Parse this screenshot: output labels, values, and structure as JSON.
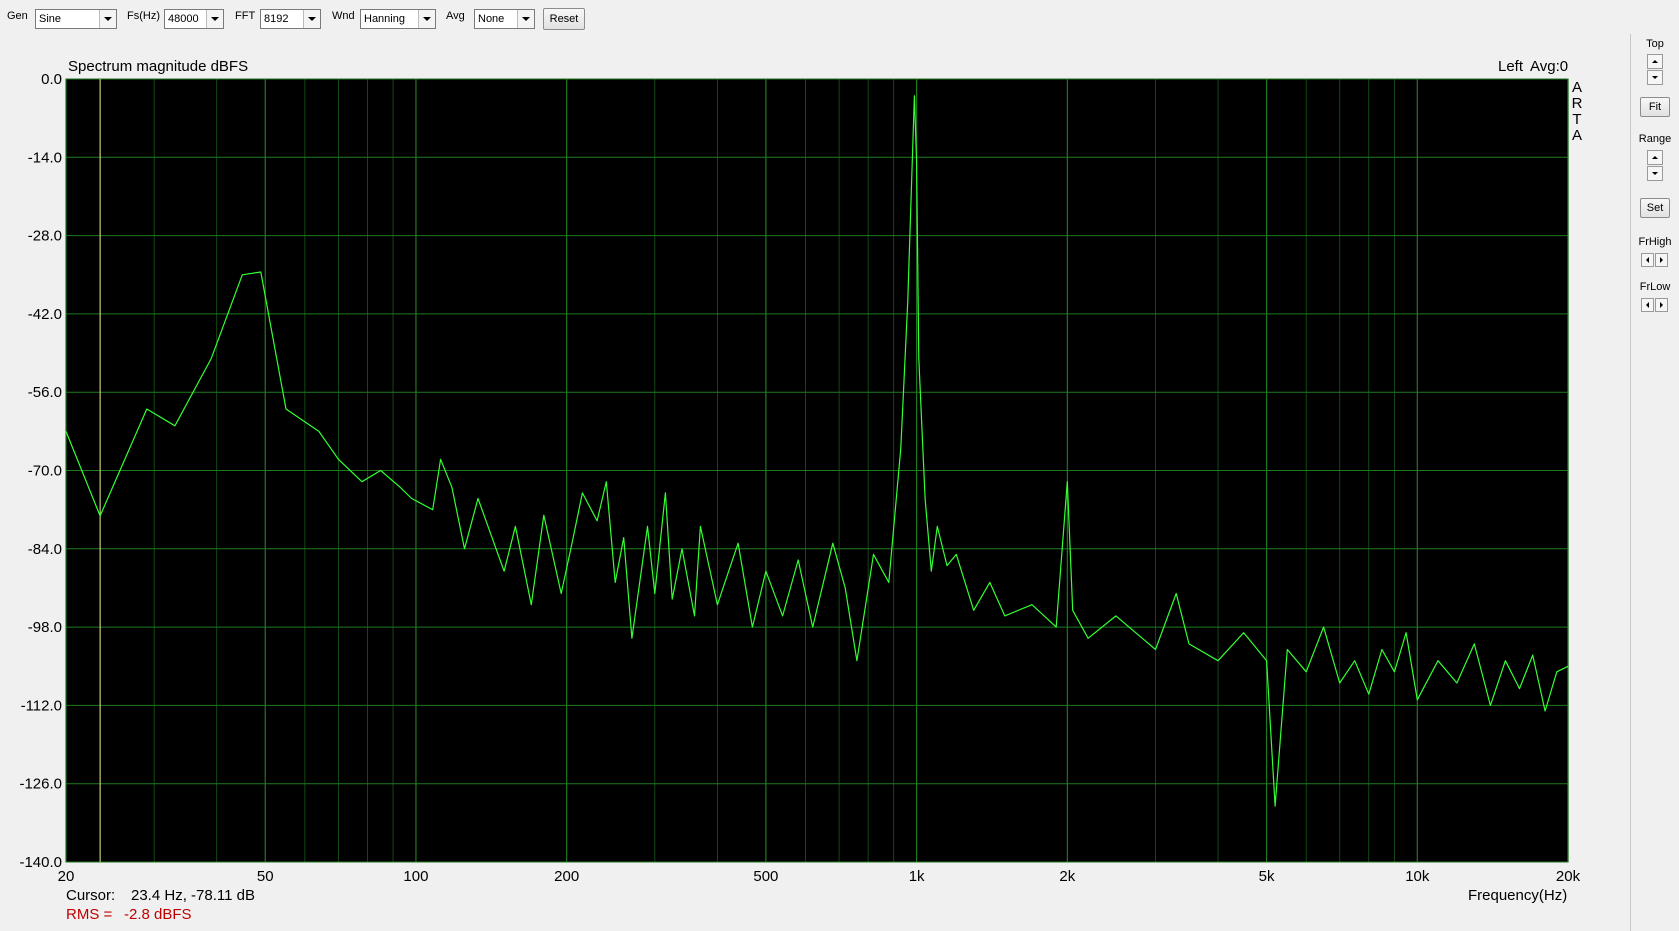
{
  "toolbar": {
    "gen_label": "Gen",
    "gen_value": "Sine",
    "fs_label": "Fs(Hz)",
    "fs_value": "48000",
    "fft_label": "FFT",
    "fft_value": "8192",
    "wnd_label": "Wnd",
    "wnd_value": "Hanning",
    "avg_label": "Avg",
    "avg_value": "None",
    "reset_label": "Reset"
  },
  "plot": {
    "title": "Spectrum magnitude dBFS",
    "channel": "Left",
    "avg_status": "Avg:0",
    "brand_letters": [
      "A",
      "R",
      "T",
      "A"
    ],
    "xaxis_title": "Frequency(Hz)",
    "cursor_label": "Cursor:",
    "cursor_value": "23.4 Hz, -78.11 dB",
    "rms_label": "RMS =",
    "rms_value": "-2.8 dBFS"
  },
  "panel": {
    "top_label": "Top",
    "fit_label": "Fit",
    "range_label": "Range",
    "set_label": "Set",
    "frhigh_label": "FrHigh",
    "frlow_label": "FrLow"
  },
  "colors": {
    "plot_background": "#000000",
    "grid": "#1f7a1f",
    "trace": "#33ff33",
    "cursor": "#c8c87a",
    "rms_text": "#c00000"
  },
  "chart_data": {
    "type": "line",
    "title": "Spectrum magnitude dBFS",
    "xlabel": "Frequency(Hz)",
    "ylabel": "",
    "xscale": "log",
    "xlim": [
      20,
      20000
    ],
    "ylim": [
      -140,
      0
    ],
    "grid": true,
    "xticks": [
      20,
      50,
      100,
      200,
      500,
      1000,
      2000,
      5000,
      10000,
      20000
    ],
    "xtick_labels": [
      "20",
      "50",
      "100",
      "200",
      "500",
      "1k",
      "2k",
      "5k",
      "10k",
      "20k"
    ],
    "yticks": [
      0,
      -14,
      -28,
      -42,
      -56,
      -70,
      -84,
      -98,
      -112,
      -126,
      -140
    ],
    "ytick_labels": [
      "0.0",
      "-14.0",
      "-28.0",
      "-42.0",
      "-56.0",
      "-70.0",
      "-84.0",
      "-98.0",
      "-112.0",
      "-126.0",
      "-140.0"
    ],
    "cursor_x": 23.4,
    "series": [
      {
        "x": [
          20,
          23.4,
          29,
          33,
          39,
          45,
          49,
          55,
          64,
          70,
          78,
          85,
          93,
          98,
          108,
          112,
          118,
          125,
          133,
          150,
          158,
          170,
          180,
          195,
          205,
          215,
          230,
          240,
          250,
          260,
          270,
          290,
          300,
          315,
          325,
          340,
          360,
          370,
          400,
          440,
          470,
          500,
          540,
          580,
          620,
          680,
          720,
          760,
          820,
          880,
          930,
          960,
          990,
          1000,
          1010,
          1040,
          1070,
          1100,
          1150,
          1200,
          1300,
          1400,
          1500,
          1700,
          1900,
          2000,
          2050,
          2200,
          2500,
          3000,
          3300,
          3500,
          4000,
          4500,
          5000,
          5200,
          5500,
          6000,
          6500,
          7000,
          7500,
          8000,
          8500,
          9000,
          9500,
          10000,
          11000,
          12000,
          13000,
          14000,
          15000,
          16000,
          17000,
          18000,
          19000,
          20000
        ],
        "y": [
          -63,
          -78.11,
          -59,
          -62,
          -50,
          -35,
          -34.5,
          -59,
          -63,
          -68,
          -72,
          -70,
          -73,
          -75,
          -77,
          -68,
          -73,
          -84,
          -75,
          -88,
          -80,
          -94,
          -78,
          -92,
          -83,
          -74,
          -79,
          -72,
          -90,
          -82,
          -100,
          -80,
          -92,
          -74,
          -93,
          -84,
          -96,
          -80,
          -94,
          -83,
          -98,
          -88,
          -96,
          -86,
          -98,
          -83,
          -91,
          -104,
          -85,
          -90,
          -66,
          -40,
          -3,
          -15,
          -50,
          -75,
          -88,
          -80,
          -87,
          -85,
          -95,
          -90,
          -96,
          -94,
          -98,
          -72,
          -95,
          -100,
          -96,
          -102,
          -92,
          -101,
          -104,
          -99,
          -104,
          -130,
          -102,
          -106,
          -98,
          -108,
          -104,
          -110,
          -102,
          -106,
          -99,
          -111,
          -104,
          -108,
          -101,
          -112,
          -104,
          -109,
          -103,
          -113,
          -106,
          -105
        ]
      }
    ]
  }
}
